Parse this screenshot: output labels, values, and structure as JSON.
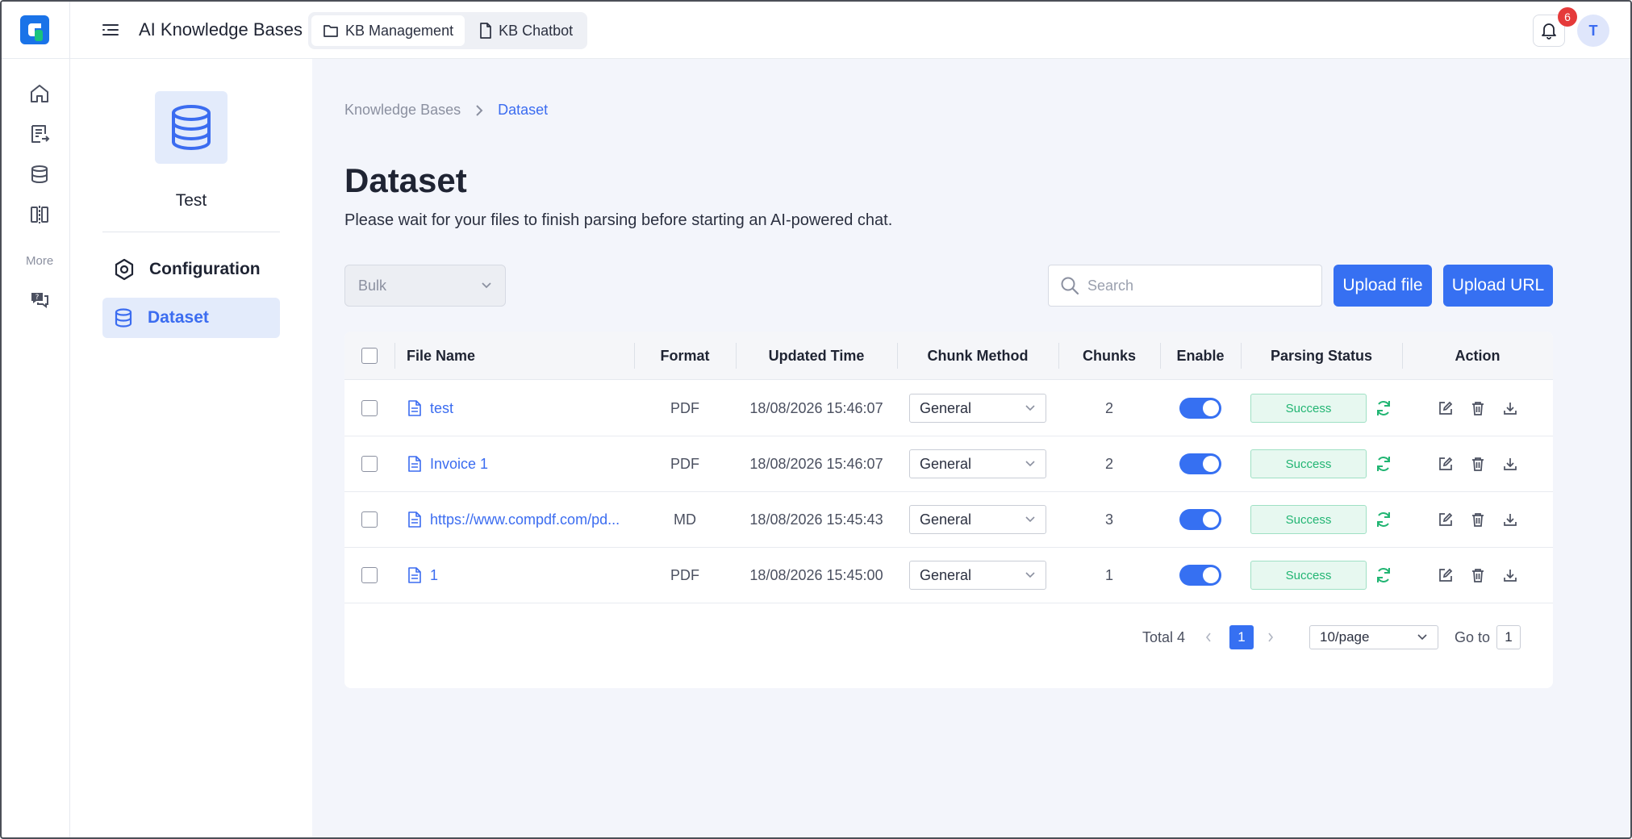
{
  "header": {
    "app_title": "AI Knowledge Bases",
    "tabs": [
      {
        "label": "KB Management",
        "icon": "folder-icon",
        "active": true
      },
      {
        "label": "KB Chatbot",
        "icon": "file-icon",
        "active": false
      }
    ],
    "notifications_count": "6",
    "avatar_initial": "T"
  },
  "rail": {
    "items": [
      "home-icon",
      "document-export-icon",
      "database-icon",
      "compare-icon"
    ],
    "more_label": "More",
    "more_items": [
      "help-chat-icon"
    ]
  },
  "kb": {
    "name": "Test",
    "nav": [
      {
        "label": "Configuration",
        "icon": "settings-hex-icon",
        "active": false
      },
      {
        "label": "Dataset",
        "icon": "database-icon",
        "active": true
      }
    ]
  },
  "breadcrumb": {
    "root": "Knowledge Bases",
    "current": "Dataset"
  },
  "page": {
    "title": "Dataset",
    "subtitle": "Please wait for your files to finish parsing before starting an AI-powered chat."
  },
  "toolbar": {
    "bulk_label": "Bulk",
    "search_placeholder": "Search",
    "upload_file": "Upload file",
    "upload_url": "Upload URL"
  },
  "table": {
    "columns": {
      "file_name": "File Name",
      "format": "Format",
      "updated": "Updated Time",
      "chunk_method": "Chunk Method",
      "chunks": "Chunks",
      "enable": "Enable",
      "status": "Parsing Status",
      "action": "Action"
    },
    "rows": [
      {
        "name": "test",
        "format": "PDF",
        "updated": "18/08/2026 15:46:07",
        "method": "General",
        "chunks": "2",
        "enabled": true,
        "status": "Success"
      },
      {
        "name": "Invoice 1",
        "format": "PDF",
        "updated": "18/08/2026 15:46:07",
        "method": "General",
        "chunks": "2",
        "enabled": true,
        "status": "Success"
      },
      {
        "name": "https://www.compdf.com/pd...",
        "format": "MD",
        "updated": "18/08/2026 15:45:43",
        "method": "General",
        "chunks": "3",
        "enabled": true,
        "status": "Success"
      },
      {
        "name": "1",
        "format": "PDF",
        "updated": "18/08/2026 15:45:00",
        "method": "General",
        "chunks": "1",
        "enabled": true,
        "status": "Success"
      }
    ]
  },
  "pagination": {
    "total": "Total 4",
    "current_page": "1",
    "page_size": "10/page",
    "goto_label": "Go to",
    "goto_value": "1"
  },
  "colors": {
    "accent": "#3670f2",
    "success": "#22b573",
    "badge": "#e53a3a"
  }
}
